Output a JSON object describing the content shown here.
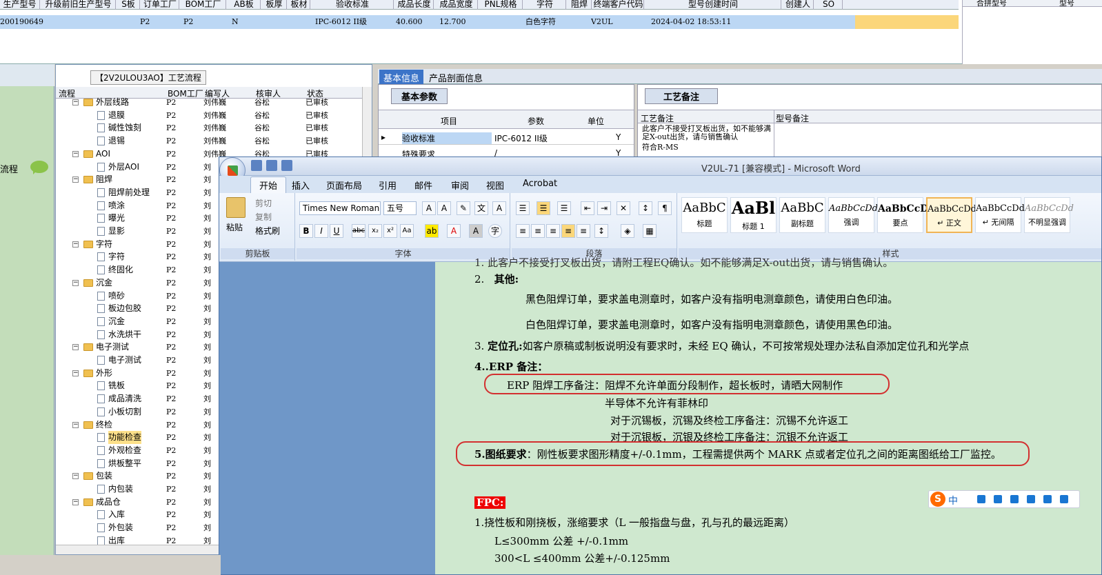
{
  "top_grid": {
    "headers": [
      "生产型号",
      "升级前旧生产型号",
      "S板",
      "订单工厂",
      "BOM工厂",
      "AB板",
      "板厚",
      "板材",
      "验收标准",
      "成品长度",
      "成品宽度",
      "PNL规格",
      "字符",
      "阻焊",
      "终端客户代码",
      "型号创建时间",
      "创建人",
      "SO"
    ],
    "row": {
      "id": "200190649",
      "s": "P2",
      "bom": "P2",
      "ab": "N",
      "std": "IPC-6012 II级",
      "length": "40.600",
      "width": "12.700",
      "char": "白色字符",
      "terminal": "V2UL",
      "created": "2024-04-02 18:53:11"
    },
    "right_headers": [
      "合拼型号",
      "型号"
    ]
  },
  "left_nav": {
    "label": "流程"
  },
  "tree": {
    "title": "【2V2ULOU3AO】工艺流程",
    "headers": [
      "流程",
      "BOM工厂",
      "编写人",
      "核审人",
      "状态"
    ],
    "rows": [
      {
        "name": "外层线路",
        "bom": "P2",
        "writer": "刘伟巍",
        "checker": "谷松",
        "status": "已审核",
        "type": "folder",
        "level": 0
      },
      {
        "name": "退膜",
        "bom": "P2",
        "writer": "刘伟巍",
        "checker": "谷松",
        "status": "已审核",
        "type": "doc",
        "level": 1
      },
      {
        "name": "碱性蚀刻",
        "bom": "P2",
        "writer": "刘伟巍",
        "checker": "谷松",
        "status": "已审核",
        "type": "doc",
        "level": 1
      },
      {
        "name": "退锡",
        "bom": "P2",
        "writer": "刘伟巍",
        "checker": "谷松",
        "status": "已审核",
        "type": "doc",
        "level": 1
      },
      {
        "name": "AOI",
        "bom": "P2",
        "writer": "刘伟巍",
        "checker": "谷松",
        "status": "已审核",
        "type": "folder",
        "level": 0
      },
      {
        "name": "外层AOI",
        "bom": "P2",
        "writer": "刘",
        "checker": "",
        "status": "",
        "type": "doc",
        "level": 1
      },
      {
        "name": "阻焊",
        "bom": "P2",
        "writer": "刘",
        "checker": "",
        "status": "",
        "type": "folder",
        "level": 0
      },
      {
        "name": "阻焊前处理",
        "bom": "P2",
        "writer": "刘",
        "checker": "",
        "status": "",
        "type": "doc",
        "level": 1
      },
      {
        "name": "喷涂",
        "bom": "P2",
        "writer": "刘",
        "checker": "",
        "status": "",
        "type": "doc",
        "level": 1
      },
      {
        "name": "曝光",
        "bom": "P2",
        "writer": "刘",
        "checker": "",
        "status": "",
        "type": "doc",
        "level": 1
      },
      {
        "name": "显影",
        "bom": "P2",
        "writer": "刘",
        "checker": "",
        "status": "",
        "type": "doc",
        "level": 1
      },
      {
        "name": "字符",
        "bom": "P2",
        "writer": "刘",
        "checker": "",
        "status": "",
        "type": "folder",
        "level": 0
      },
      {
        "name": "字符",
        "bom": "P2",
        "writer": "刘",
        "checker": "",
        "status": "",
        "type": "doc",
        "level": 1
      },
      {
        "name": "终固化",
        "bom": "P2",
        "writer": "刘",
        "checker": "",
        "status": "",
        "type": "doc",
        "level": 1
      },
      {
        "name": "沉金",
        "bom": "P2",
        "writer": "刘",
        "checker": "",
        "status": "",
        "type": "folder",
        "level": 0
      },
      {
        "name": "喷砂",
        "bom": "P2",
        "writer": "刘",
        "checker": "",
        "status": "",
        "type": "doc",
        "level": 1
      },
      {
        "name": "板边包胶",
        "bom": "P2",
        "writer": "刘",
        "checker": "",
        "status": "",
        "type": "doc",
        "level": 1
      },
      {
        "name": "沉金",
        "bom": "P2",
        "writer": "刘",
        "checker": "",
        "status": "",
        "type": "doc",
        "level": 1
      },
      {
        "name": "水洗烘干",
        "bom": "P2",
        "writer": "刘",
        "checker": "",
        "status": "",
        "type": "doc",
        "level": 1
      },
      {
        "name": "电子测试",
        "bom": "P2",
        "writer": "刘",
        "checker": "",
        "status": "",
        "type": "folder",
        "level": 0
      },
      {
        "name": "电子测试",
        "bom": "P2",
        "writer": "刘",
        "checker": "",
        "status": "",
        "type": "doc",
        "level": 1
      },
      {
        "name": "外形",
        "bom": "P2",
        "writer": "刘",
        "checker": "",
        "status": "",
        "type": "folder",
        "level": 0
      },
      {
        "name": "铣板",
        "bom": "P2",
        "writer": "刘",
        "checker": "",
        "status": "",
        "type": "doc",
        "level": 1
      },
      {
        "name": "成品清洗",
        "bom": "P2",
        "writer": "刘",
        "checker": "",
        "status": "",
        "type": "doc",
        "level": 1
      },
      {
        "name": "小板切割",
        "bom": "P2",
        "writer": "刘",
        "checker": "",
        "status": "",
        "type": "doc",
        "level": 1
      },
      {
        "name": "终检",
        "bom": "P2",
        "writer": "刘",
        "checker": "",
        "status": "",
        "type": "folder",
        "level": 0
      },
      {
        "name": "功能检查",
        "bom": "P2",
        "writer": "刘",
        "checker": "",
        "status": "",
        "type": "doc",
        "level": 1,
        "selected": true
      },
      {
        "name": "外观检查",
        "bom": "P2",
        "writer": "刘",
        "checker": "",
        "status": "",
        "type": "doc",
        "level": 1
      },
      {
        "name": "烘板整平",
        "bom": "P2",
        "writer": "刘",
        "checker": "",
        "status": "",
        "type": "doc",
        "level": 1
      },
      {
        "name": "包装",
        "bom": "P2",
        "writer": "刘",
        "checker": "",
        "status": "",
        "type": "folder",
        "level": 0
      },
      {
        "name": "内包装",
        "bom": "P2",
        "writer": "刘",
        "checker": "",
        "status": "",
        "type": "doc",
        "level": 1
      },
      {
        "name": "成品仓",
        "bom": "P2",
        "writer": "刘",
        "checker": "",
        "status": "",
        "type": "folder",
        "level": 0
      },
      {
        "name": "入库",
        "bom": "P2",
        "writer": "刘",
        "checker": "",
        "status": "",
        "type": "doc",
        "level": 1
      },
      {
        "name": "外包装",
        "bom": "P2",
        "writer": "刘",
        "checker": "",
        "status": "",
        "type": "doc",
        "level": 1
      },
      {
        "name": "出库",
        "bom": "P2",
        "writer": "刘",
        "checker": "",
        "status": "",
        "type": "doc",
        "level": 1
      }
    ]
  },
  "info_tabs": {
    "basic": "基本信息",
    "profile": "产品剖面信息"
  },
  "basic_params": {
    "tab": "基本参数",
    "headers": [
      "项目",
      "参数",
      "单位"
    ],
    "rows": [
      {
        "item": "验收标准",
        "param": "IPC-6012 II级",
        "unit": "",
        "extra": "Y"
      },
      {
        "item": "特殊要求",
        "param": "/",
        "unit": "",
        "extra": "Y"
      }
    ]
  },
  "process_notes": {
    "tab": "工艺备注",
    "headers": [
      "工艺备注",
      "型号备注"
    ],
    "note": "此客户不接受打叉板出货，如不能够满足X-out出货，请与销售确认",
    "note2": "符合R-MS"
  },
  "word": {
    "title": "V2UL-71 [兼容模式] - Microsoft Word",
    "tabs": [
      "开始",
      "插入",
      "页面布局",
      "引用",
      "邮件",
      "审阅",
      "视图",
      "Acrobat"
    ],
    "clipboard": {
      "paste": "粘贴",
      "cut": "剪切",
      "copy": "复制",
      "format": "格式刷",
      "label": "剪贴板"
    },
    "font": {
      "family": "Times New Roman",
      "size": "五号",
      "label": "字体"
    },
    "paragraph_label": "段落",
    "styles_label": "样式",
    "styles": [
      {
        "preview": "AaBbC",
        "name": "标题"
      },
      {
        "preview": "AaBl",
        "name": "标题 1"
      },
      {
        "preview": "AaBbC",
        "name": "副标题"
      },
      {
        "preview": "AaBbCcDd",
        "name": "强调"
      },
      {
        "preview": "AaBbCcD",
        "name": "要点"
      },
      {
        "preview": "AaBbCcDd",
        "name": "↵ 正文",
        "active": true
      },
      {
        "preview": "AaBbCcDd",
        "name": "↵ 无间隔"
      },
      {
        "preview": "AaBbCcDd",
        "name": "不明显强调"
      }
    ]
  },
  "doc": {
    "l0": "1.  此客户不接受打叉板出货，请附工程EQ确认。如不能够满足X-out出货，请与销售确认。",
    "l1_num": "2.",
    "l1": "其他:",
    "l2": "黑色阻焊订单，要求盖电测章时，如客户没有指明电测章颜色，请使用白色印油。",
    "l3": "白色阻焊订单，要求盖电测章时，如客户没有指明电测章颜色，请使用黑色印油。",
    "l4_num": "3.",
    "l4_b": "定位孔:",
    "l4": "如客户原稿或制板说明没有要求时，未经 EQ 确认，不可按常规处理办法私自添加定位孔和光学点",
    "l5": "4..ERP 备注：",
    "l6": "ERP 阻焊工序备注：阻焊不允许单面分段制作，超长板时，请晒大网制作",
    "l7": "半导体不允许有菲林印",
    "l8": "对于沉锡板，沉锡及终检工序备注：沉锡不允许返工",
    "l9": "对于沉银板，沉银及终检工序备注：沉银不允许返工",
    "l10_b": "5.图纸要求",
    "l10": "：刚性板要求图形精度+/-0.1mm，工程需提供两个 MARK 点或者定位孔之间的距离图纸给工厂监控。",
    "fpc": "FPC:",
    "l11": "1.挠性板和刚挠板，涨缩要求（L 一般指盘与盘，孔与孔的最远距离）",
    "l12": "L≤300mm 公差 +/-0.1mm",
    "l13": "300<L ≤400mm 公差+/-0.125mm"
  },
  "ime": {
    "logo": "S",
    "mode": "中"
  }
}
